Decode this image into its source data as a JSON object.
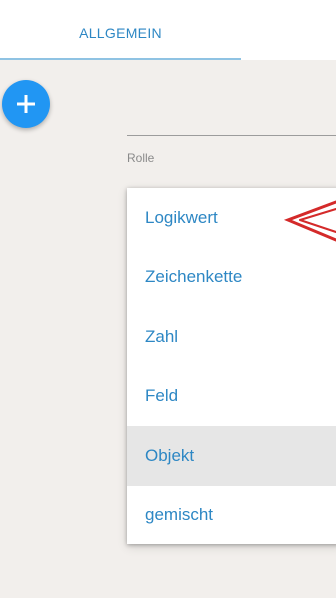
{
  "tabs": [
    {
      "label": "ALLGEMEIN",
      "active": true
    }
  ],
  "fab": {
    "icon": "plus-icon"
  },
  "field": {
    "label": "Rolle"
  },
  "menu": {
    "items": [
      {
        "label": "Logikwert"
      },
      {
        "label": "Zeichenkette"
      },
      {
        "label": "Zahl"
      },
      {
        "label": "Feld"
      },
      {
        "label": "Objekt",
        "highlighted": true
      },
      {
        "label": "gemischt"
      }
    ]
  },
  "annotation": {
    "icon": "red-arrow-icon",
    "color": "#d42a2a"
  },
  "colors": {
    "accent": "#2d87c4",
    "fab": "#2196f3",
    "background": "#f2efec",
    "highlight": "#e6e6e6"
  }
}
